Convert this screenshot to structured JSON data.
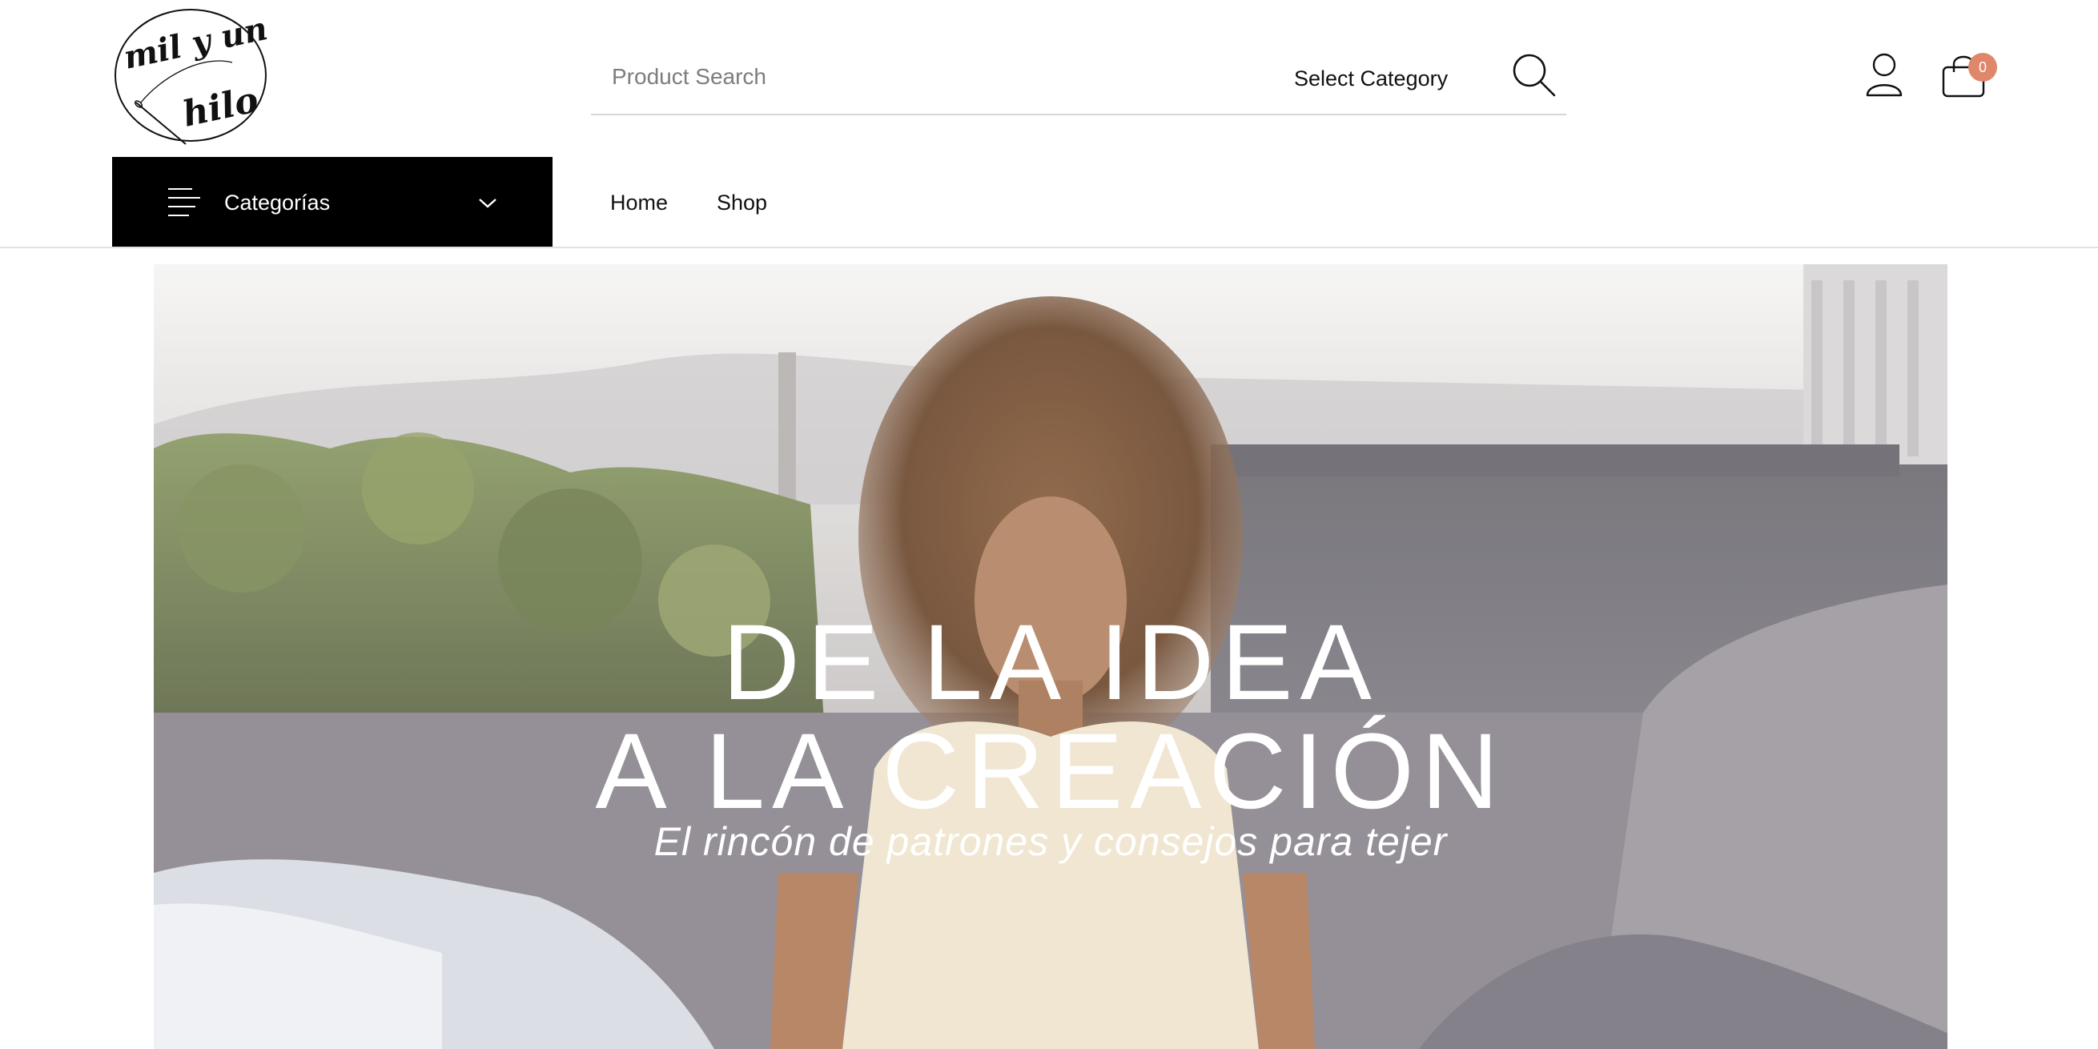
{
  "logo": {
    "text_line1": "mil y un",
    "text_line2": "hilo"
  },
  "search": {
    "placeholder": "Product Search",
    "value": "",
    "category_select": "Select Category"
  },
  "header": {
    "cart_count": "0"
  },
  "nav": {
    "categories_label": "Categorías",
    "links": [
      "Home",
      "Shop"
    ]
  },
  "hero": {
    "title_line1": "DE LA IDEA",
    "title_line2": "A LA CREACIÓN",
    "subtitle": "El rincón de patrones y consejos para tejer"
  },
  "icons": {
    "search": "search-icon",
    "account": "user-icon",
    "cart": "shopping-bag-icon",
    "menu": "hamburger-menu-icon",
    "dropdown": "chevron-down-icon"
  },
  "colors": {
    "accent": "#e0866a",
    "categories_bg": "#000000",
    "text": "#111111",
    "hero_text": "#ffffff"
  }
}
